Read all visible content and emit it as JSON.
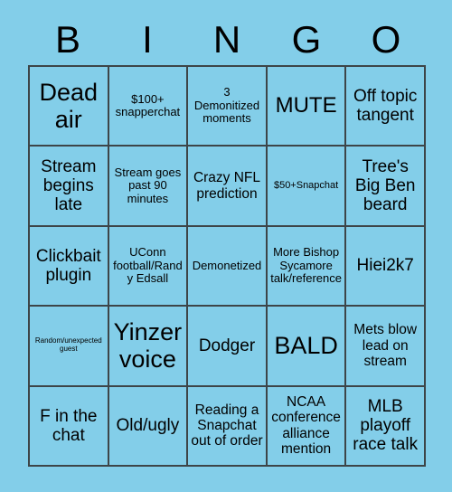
{
  "card": {
    "background_color": "#83cee9",
    "border_color": "#3d4548",
    "text_color": "#000000"
  },
  "header": {
    "letters": [
      {
        "label": "B"
      },
      {
        "label": "I"
      },
      {
        "label": "N"
      },
      {
        "label": "G"
      },
      {
        "label": "O"
      }
    ]
  },
  "grid": {
    "columns": 5,
    "rows": 5,
    "cells": [
      {
        "text": "Dead air",
        "size": "fs-xxl"
      },
      {
        "text": "$100+ snapperchat",
        "size": "fs-s"
      },
      {
        "text": "3 Demonitized moments",
        "size": "fs-s"
      },
      {
        "text": "MUTE",
        "size": "fs-xl"
      },
      {
        "text": "Off topic tangent",
        "size": "fs-l"
      },
      {
        "text": "Stream begins late",
        "size": "fs-l"
      },
      {
        "text": "Stream goes past 90 minutes",
        "size": "fs-s"
      },
      {
        "text": "Crazy NFL prediction",
        "size": "fs-m"
      },
      {
        "text": "$50+Snapchat",
        "size": "fs-xs"
      },
      {
        "text": "Tree's Big Ben beard",
        "size": "fs-l"
      },
      {
        "text": "Clickbait plugin",
        "size": "fs-l"
      },
      {
        "text": "UConn football/Randy Edsall",
        "size": "fs-s"
      },
      {
        "text": "Demonetized",
        "size": "fs-s"
      },
      {
        "text": "More Bishop Sycamore talk/reference",
        "size": "fs-s"
      },
      {
        "text": "Hiei2k7",
        "size": "fs-l"
      },
      {
        "text": "Random/unexpected guest",
        "size": "fs-xxs"
      },
      {
        "text": "Yinzer voice",
        "size": "fs-xxl"
      },
      {
        "text": "Dodger",
        "size": "fs-l"
      },
      {
        "text": "BALD",
        "size": "fs-xxl"
      },
      {
        "text": "Mets blow lead on stream",
        "size": "fs-m"
      },
      {
        "text": "F in the chat",
        "size": "fs-l"
      },
      {
        "text": "Old/ugly",
        "size": "fs-l"
      },
      {
        "text": "Reading a Snapchat out of order",
        "size": "fs-m"
      },
      {
        "text": "NCAA conference alliance mention",
        "size": "fs-m"
      },
      {
        "text": "MLB playoff race talk",
        "size": "fs-l"
      }
    ]
  }
}
